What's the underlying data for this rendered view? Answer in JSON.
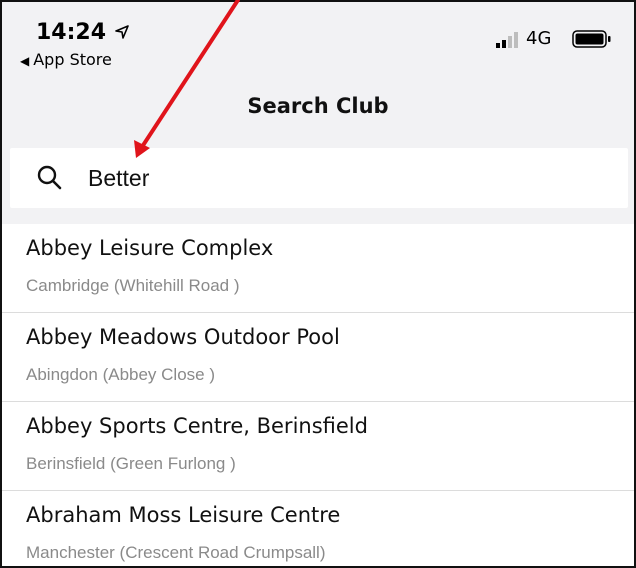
{
  "status_bar": {
    "time": "14:24",
    "back_app": "App Store",
    "network": "4G"
  },
  "nav": {
    "title": "Search Club"
  },
  "search": {
    "value": "Better",
    "icon": "search-icon"
  },
  "results": [
    {
      "name": "Abbey Leisure Complex",
      "location": "Cambridge (Whitehill Road )"
    },
    {
      "name": "Abbey Meadows Outdoor Pool",
      "location": "Abingdon (Abbey Close )"
    },
    {
      "name": "Abbey Sports Centre, Berinsfield",
      "location": "Berinsfield (Green Furlong )"
    },
    {
      "name": "Abraham Moss Leisure Centre",
      "location": "Manchester (Crescent Road Crumpsall)"
    }
  ],
  "colors": {
    "annotation_arrow": "#e0141b",
    "background": "#f2f2f4",
    "subtext": "#8a8a8a"
  }
}
